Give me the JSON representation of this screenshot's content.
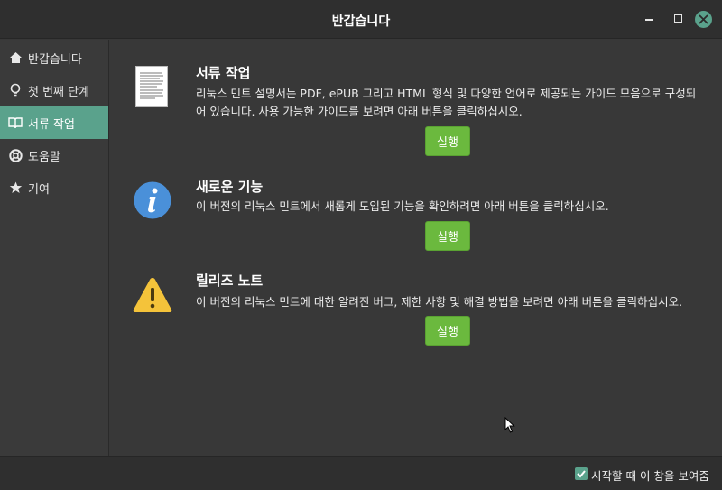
{
  "window": {
    "title": "반갑습니다",
    "controls": {
      "minimize_icon": "minimize-icon",
      "maximize_icon": "maximize-icon",
      "close_icon": "close-icon"
    }
  },
  "sidebar": {
    "items": [
      {
        "label": "반갑습니다",
        "icon": "home-icon",
        "active": false
      },
      {
        "label": "첫 번째 단계",
        "icon": "lightbulb-icon",
        "active": false
      },
      {
        "label": "서류 작업",
        "icon": "book-icon",
        "active": true
      },
      {
        "label": "도움말",
        "icon": "lifebuoy-icon",
        "active": false
      },
      {
        "label": "기여",
        "icon": "star-icon",
        "active": false
      }
    ]
  },
  "sections": [
    {
      "icon": "document-icon",
      "heading": "서류 작업",
      "description": "리눅스 민트 설명서는 PDF, ePUB 그리고 HTML 형식 및 다양한 언어로 제공되는 가이드 모음으로 구성되어 있습니다. 사용 가능한 가이드를 보려면 아래 버튼을 클릭하십시오.",
      "button": "실행"
    },
    {
      "icon": "info-icon",
      "heading": "새로운 기능",
      "description": "이 버전의 리눅스 민트에서 새롭게 도입된 기능을 확인하려면 아래 버튼을 클릭하십시오.",
      "button": "실행"
    },
    {
      "icon": "warning-icon",
      "heading": "릴리즈 노트",
      "description": "이 버전의 리눅스 민트에 대한 알려진 버그, 제한 사항 및 해결 방법을 보려면 아래 버튼을 클릭하십시오.",
      "button": "실행"
    }
  ],
  "footer": {
    "show_on_startup_label": "시작할 때 이 창을 보여줌",
    "show_on_startup_checked": true
  },
  "colors": {
    "accent": "#5aa28c",
    "button_green": "#6bb93e",
    "info_blue": "#4a90d9",
    "warning_yellow": "#f4c33a"
  }
}
